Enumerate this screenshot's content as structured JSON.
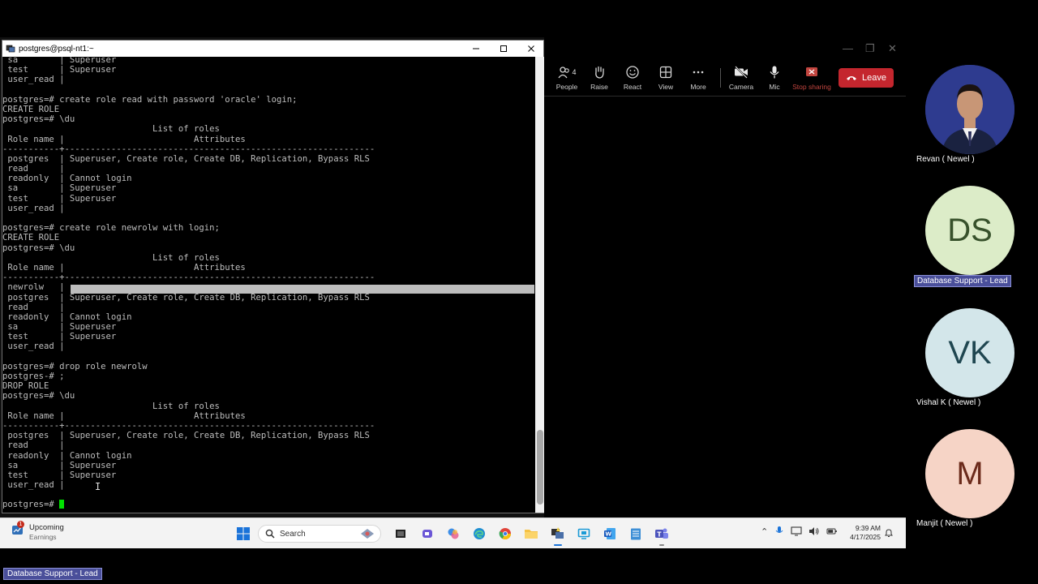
{
  "putty": {
    "title": "postgres@psql-nt1:~",
    "terminal_lines": [
      " sa        | Superuser",
      " test      | Superuser",
      " user_read |",
      "",
      "postgres=# create role read with password 'oracle' login;",
      "CREATE ROLE",
      "postgres=# \\du",
      "                             List of roles",
      " Role name |                         Attributes",
      "-----------+------------------------------------------------------------",
      " postgres  | Superuser, Create role, Create DB, Replication, Bypass RLS",
      " read      |",
      " readonly  | Cannot login",
      " sa        | Superuser",
      " test      | Superuser",
      " user_read |",
      "",
      "postgres=# create role newrolw with login;",
      "CREATE ROLE",
      "postgres=# \\du",
      "                             List of roles",
      " Role name |                         Attributes",
      "-----------+------------------------------------------------------------",
      " newrolw   |",
      " postgres  | Superuser, Create role, Create DB, Replication, Bypass RLS",
      " read      |",
      " readonly  | Cannot login",
      " sa        | Superuser",
      " test      | Superuser",
      " user_read |",
      "",
      "postgres=# drop role newrolw",
      "postgres-# ;",
      "DROP ROLE",
      "postgres=# \\du",
      "                             List of roles",
      " Role name |                         Attributes",
      "-----------+------------------------------------------------------------",
      " postgres  | Superuser, Create role, Create DB, Replication, Bypass RLS",
      " read      |",
      " readonly  | Cannot login",
      " sa        | Superuser",
      " test      | Superuser",
      " user_read |",
      "",
      "postgres=# "
    ]
  },
  "meeting": {
    "people_count": "4",
    "toolbar": {
      "people": "People",
      "raise": "Raise",
      "react": "React",
      "view": "View",
      "more": "More",
      "camera": "Camera",
      "mic": "Mic",
      "stop_sharing": "Stop sharing",
      "leave": "Leave"
    },
    "participants": [
      {
        "name": "Revan ( Newel )",
        "initials": "",
        "avatar_color": "#2e3b8f"
      },
      {
        "name": "Database Support - Lead",
        "initials": "DS",
        "avatar_color": "#dcecc8"
      },
      {
        "name": "Vishal K ( Newel )",
        "initials": "VK",
        "avatar_color": "#d3e6ea"
      },
      {
        "name": "Manjit ( Newel )",
        "initials": "M",
        "avatar_color": "#f6d4c6"
      }
    ],
    "presenter_label": "Database Support - Lead"
  },
  "taskbar": {
    "weather_title": "Upcoming",
    "weather_subtitle": "Earnings",
    "weather_badge": "1",
    "search_label": "Search",
    "time": "9:39 AM",
    "date": "4/17/2025"
  },
  "colors": {
    "terminal_text": "#bdbdbd",
    "cursor": "#00e000",
    "leave": "#c4262e",
    "highlight": "#bdbdbd"
  }
}
